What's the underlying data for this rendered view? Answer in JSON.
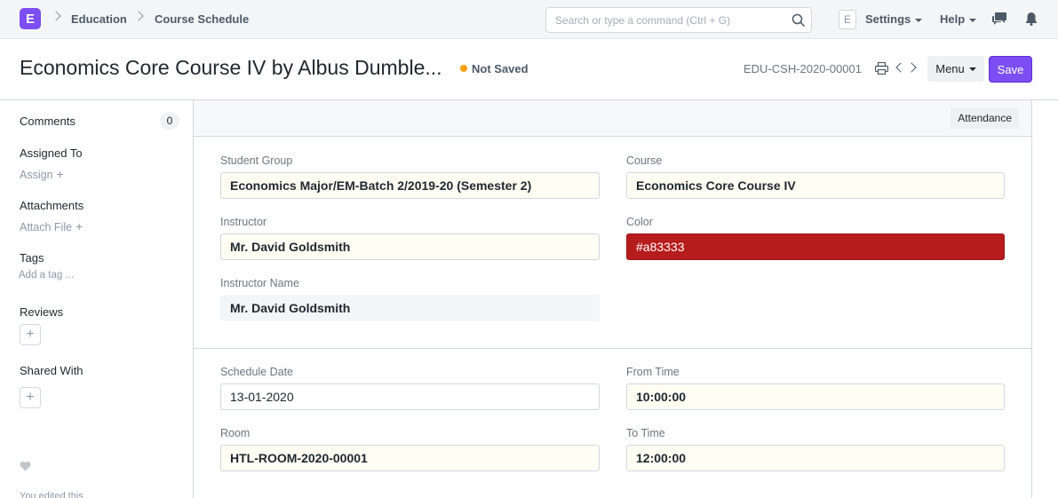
{
  "navbar": {
    "logo": "E",
    "breadcrumbs": [
      "Education",
      "Course Schedule"
    ],
    "search_placeholder": "Search or type a command (Ctrl + G)",
    "avatar_letter": "E",
    "settings_label": "Settings",
    "help_label": "Help"
  },
  "page": {
    "title": "Economics Core Course IV by Albus Dumble...",
    "status": "Not Saved",
    "doc_name": "EDU-CSH-2020-00001",
    "menu_label": "Menu",
    "save_label": "Save",
    "status_color": "#ffa00a",
    "accent_color": "#7c4df2"
  },
  "sidebar": {
    "comments_label": "Comments",
    "comments_count": "0",
    "assigned_to_label": "Assigned To",
    "assign_link": "Assign",
    "attachments_label": "Attachments",
    "attach_link": "Attach File",
    "tags_label": "Tags",
    "tag_link": "Add a tag ...",
    "reviews_label": "Reviews",
    "shared_with_label": "Shared With",
    "add_symbol": "+",
    "edited_text": "You edited this"
  },
  "form": {
    "attendance_label": "Attendance",
    "student_group": {
      "label": "Student Group",
      "value": "Economics Major/EM-Batch 2/2019-20 (Semester 2)"
    },
    "course": {
      "label": "Course",
      "value": "Economics Core Course IV"
    },
    "instructor": {
      "label": "Instructor",
      "value": "Mr. David Goldsmith"
    },
    "color": {
      "label": "Color",
      "value": "#a83333"
    },
    "instructor_name": {
      "label": "Instructor Name",
      "value": "Mr. David Goldsmith"
    },
    "schedule_date": {
      "label": "Schedule Date",
      "value": "13-01-2020"
    },
    "from_time": {
      "label": "From Time",
      "value": "10:00:00"
    },
    "room": {
      "label": "Room",
      "value": "HTL-ROOM-2020-00001"
    },
    "to_time": {
      "label": "To Time",
      "value": "12:00:00"
    }
  }
}
